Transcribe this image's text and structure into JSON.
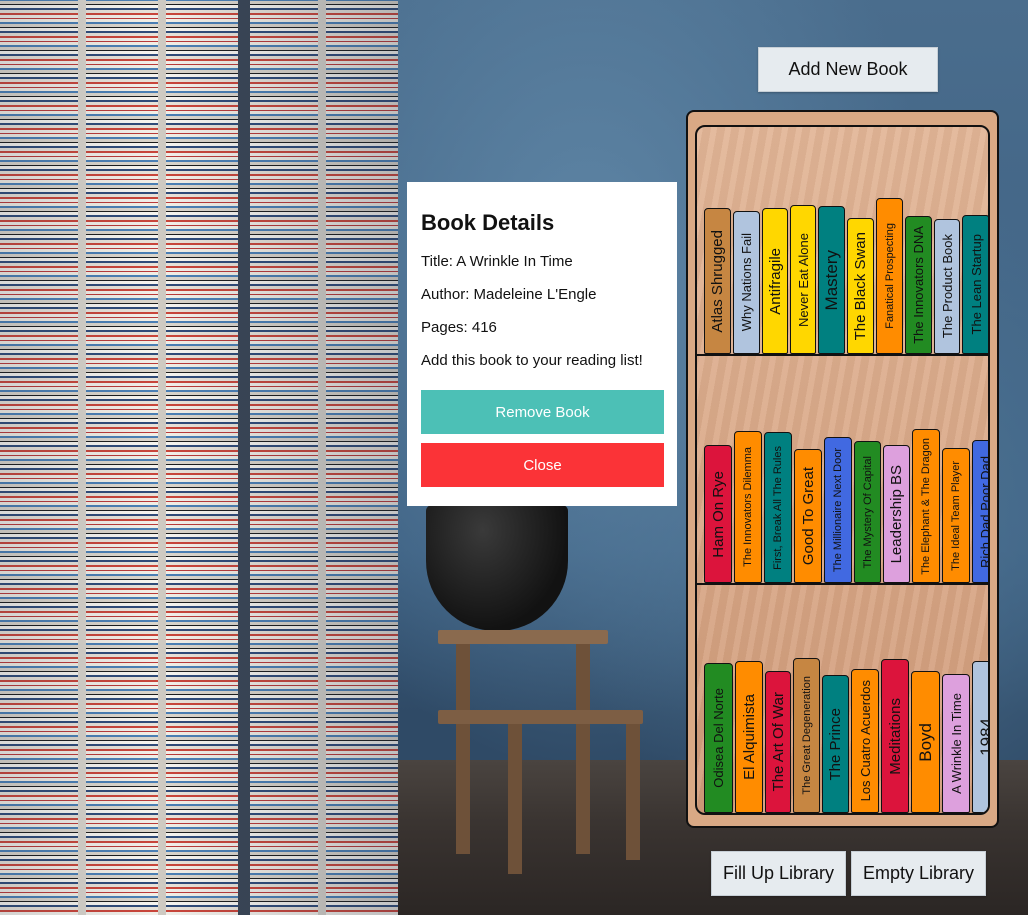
{
  "buttons": {
    "add_new_book": "Add New Book",
    "fill_up_library": "Fill Up Library",
    "empty_library": "Empty Library"
  },
  "modal": {
    "title": "Book Details",
    "title_line": "Title: A Wrinkle In Time",
    "author_line": "Author: Madeleine L'Engle",
    "pages_line": "Pages: 416",
    "message": "Add this book to your reading list!",
    "remove_label": "Remove Book",
    "close_label": "Close"
  },
  "colors": {
    "brown": "#c68642",
    "lightblue": "#b0c4de",
    "yellow": "#ffd700",
    "teal": "#008080",
    "orange": "#ff8c00",
    "green": "#228b22",
    "crimson": "#dc143c",
    "blue": "#4169e1",
    "plum": "#dda0dd",
    "remove_button": "#4cc0b6",
    "close_button": "#fb3337"
  },
  "shelves": [
    [
      {
        "title": "Atlas Shrugged",
        "color": "#c68642"
      },
      {
        "title": "Why Nations Fail",
        "color": "#b0c4de"
      },
      {
        "title": "Antifragile",
        "color": "#ffd700"
      },
      {
        "title": "Never Eat Alone",
        "color": "#ffd700"
      },
      {
        "title": "Mastery",
        "color": "#008080"
      },
      {
        "title": "The Black Swan",
        "color": "#ffd700"
      },
      {
        "title": "Fanatical Prospecting",
        "color": "#ff8c00"
      },
      {
        "title": "The Innovators DNA",
        "color": "#228b22"
      },
      {
        "title": "The Product Book",
        "color": "#b0c4de"
      },
      {
        "title": "The Lean Startup",
        "color": "#008080"
      }
    ],
    [
      {
        "title": "Ham On Rye",
        "color": "#dc143c"
      },
      {
        "title": "The Innovators Dilemma",
        "color": "#ff8c00"
      },
      {
        "title": "First, Break All The Rules",
        "color": "#008080"
      },
      {
        "title": "Good To Great",
        "color": "#ff8c00"
      },
      {
        "title": "The Millionaire Next Door",
        "color": "#4169e1"
      },
      {
        "title": "The Mystery Of Capital",
        "color": "#228b22"
      },
      {
        "title": "Leadership BS",
        "color": "#dda0dd"
      },
      {
        "title": "The Elephant & The Dragon",
        "color": "#ff8c00"
      },
      {
        "title": "The Ideal Team Player",
        "color": "#ff8c00"
      },
      {
        "title": "Rich Dad Poor Dad",
        "color": "#4169e1"
      }
    ],
    [
      {
        "title": "Odisea Del Norte",
        "color": "#228b22"
      },
      {
        "title": "El Alquimista",
        "color": "#ff8c00"
      },
      {
        "title": "The Art Of War",
        "color": "#dc143c"
      },
      {
        "title": "The Great Degeneration",
        "color": "#c68642"
      },
      {
        "title": "The Prince",
        "color": "#008080"
      },
      {
        "title": "Los Cuatro Acuerdos",
        "color": "#ff8c00"
      },
      {
        "title": "Meditations",
        "color": "#dc143c"
      },
      {
        "title": "Boyd",
        "color": "#ff8c00"
      },
      {
        "title": "A Wrinkle In Time",
        "color": "#dda0dd"
      },
      {
        "title": "1984",
        "color": "#b0c4de"
      }
    ]
  ]
}
